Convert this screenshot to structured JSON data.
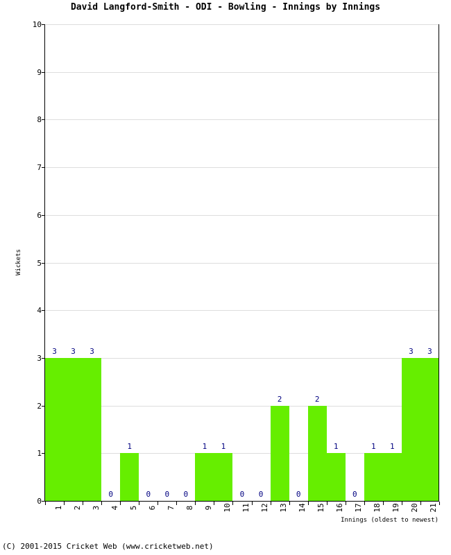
{
  "chart_data": {
    "type": "bar",
    "title": "David Langford-Smith - ODI - Bowling - Innings by Innings",
    "xlabel": "Innings (oldest to newest)",
    "ylabel": "Wickets",
    "categories": [
      "1",
      "2",
      "3",
      "4",
      "5",
      "6",
      "7",
      "8",
      "9",
      "10",
      "11",
      "12",
      "13",
      "14",
      "15",
      "16",
      "17",
      "18",
      "19",
      "20",
      "21"
    ],
    "values": [
      3,
      3,
      3,
      0,
      1,
      0,
      0,
      0,
      1,
      1,
      0,
      0,
      2,
      0,
      2,
      1,
      0,
      1,
      1,
      3,
      3
    ],
    "ylim": [
      0,
      10
    ],
    "yticks": [
      0,
      1,
      2,
      3,
      4,
      5,
      6,
      7,
      8,
      9,
      10
    ],
    "ytick_labels": [
      "0",
      "1",
      "2",
      "3",
      "4",
      "5",
      "6",
      "7",
      "8",
      "9",
      "10"
    ],
    "grid": true,
    "legend": false,
    "bar_color": "#66ee00",
    "value_label_color": "#000080",
    "gridline_color": "#dddddd",
    "axis_color": "#000000"
  },
  "footer": {
    "copyright": "(C) 2001-2015 Cricket Web (www.cricketweb.net)"
  }
}
